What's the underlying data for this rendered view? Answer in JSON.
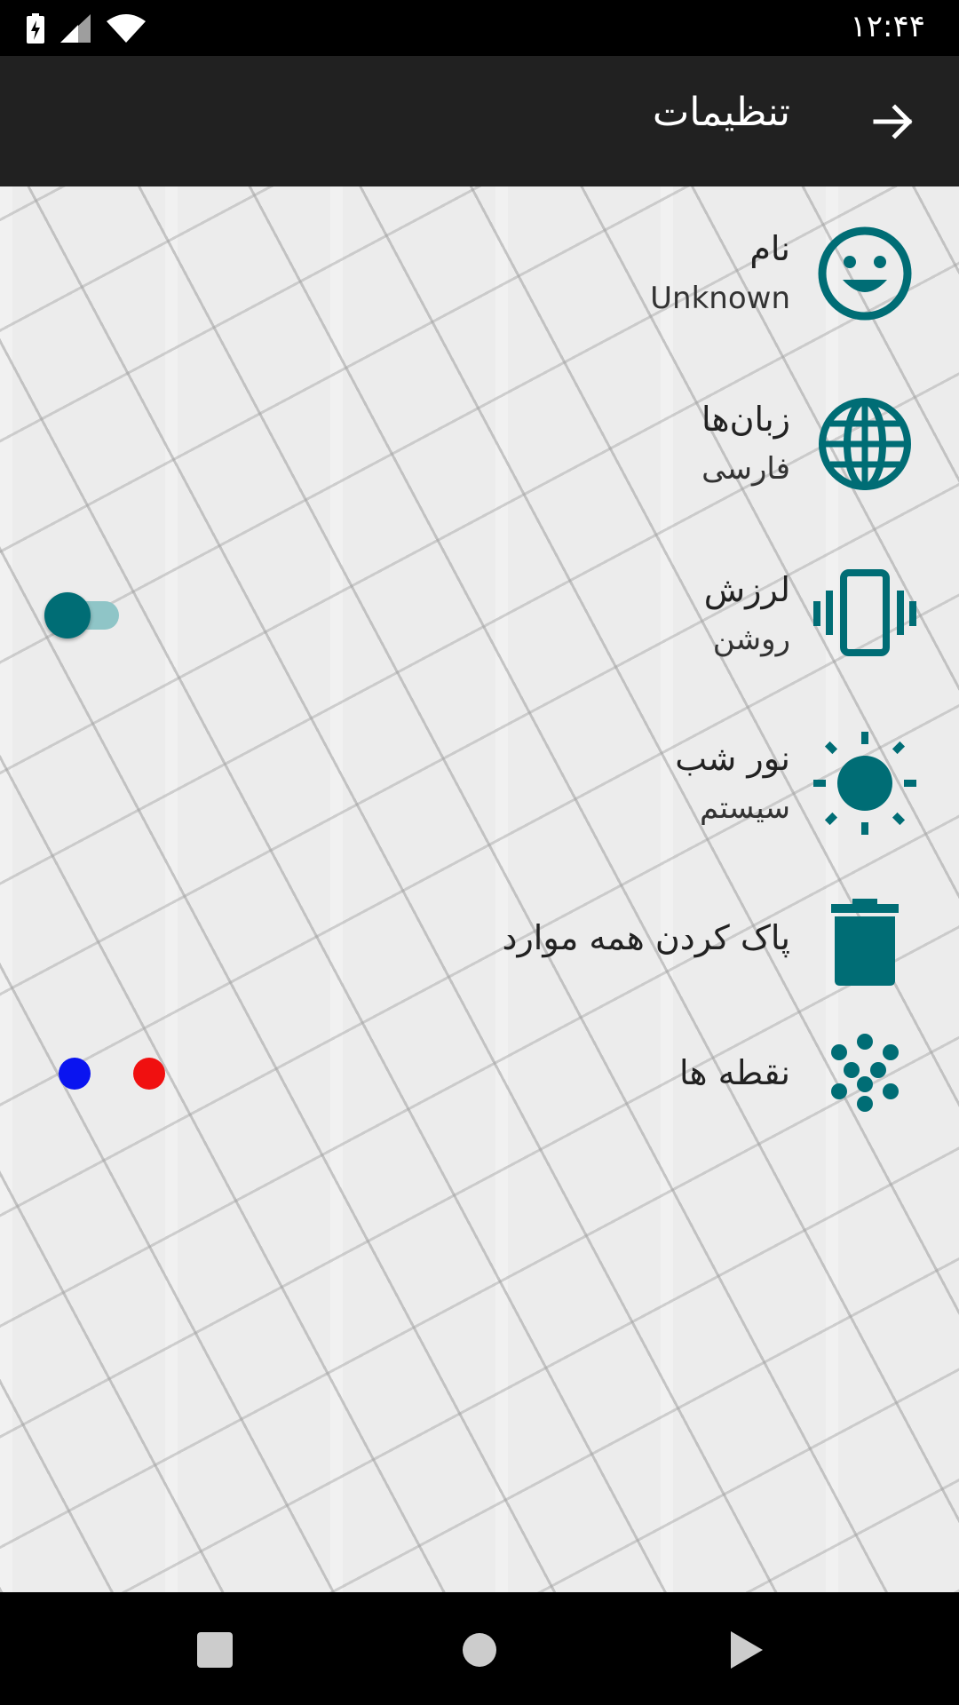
{
  "status_bar": {
    "time": "۱۲:۴۴",
    "icons": [
      "battery-charging-icon",
      "cell-signal-icon",
      "wifi-icon"
    ]
  },
  "app_bar": {
    "title": "تنظیمات",
    "back_icon": "arrow-forward-icon"
  },
  "colors": {
    "accent": "#006d75",
    "toggle_track": "#8fc5c7",
    "app_bar_bg": "#212121",
    "dot_blue": "#0a14f0",
    "dot_red": "#f01010"
  },
  "settings": [
    {
      "title": "نام",
      "subtitle": "Unknown",
      "icon": "smiley-face-icon"
    },
    {
      "title": "زبان‌ها",
      "subtitle": "فارسی",
      "icon": "globe-icon"
    },
    {
      "title": "لرزش",
      "subtitle": "روشن",
      "icon": "vibration-icon",
      "toggle_on": true
    },
    {
      "title": "نور شب",
      "subtitle": "سیستم",
      "icon": "brightness-icon"
    },
    {
      "title": "پاک کردن همه موارد",
      "icon": "trash-icon"
    },
    {
      "title": "نقطه ها",
      "icon": "dots-icon",
      "dot_colors": [
        "#0a14f0",
        "#f01010"
      ]
    }
  ],
  "nav_bar": {
    "buttons": [
      "recents-square-icon",
      "home-circle-icon",
      "back-triangle-icon"
    ]
  }
}
